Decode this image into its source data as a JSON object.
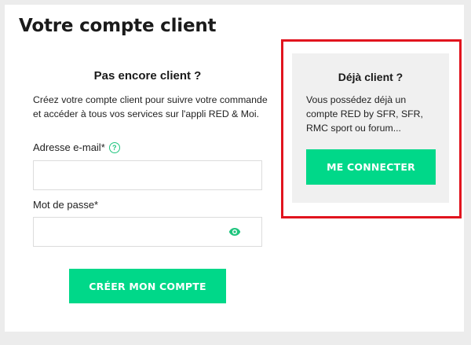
{
  "page": {
    "title": "Votre compte client"
  },
  "signup": {
    "title": "Pas encore client ?",
    "intro": "Créez votre compte client pour suivre votre commande et accéder à tous vos services sur l'appli RED & Moi.",
    "email_label": "Adresse e-mail*",
    "email_value": "",
    "password_label": "Mot de passe*",
    "password_value": "",
    "create_button": "CRÉER MON COMPTE"
  },
  "login": {
    "title": "Déjà client ?",
    "text": "Vous possédez déjà un compte RED by SFR, SFR, RMC sport ou forum...",
    "connect_button": "ME CONNECTER"
  },
  "colors": {
    "accent": "#00d889",
    "highlight": "#e1141e",
    "panel": "#f0f0f0"
  },
  "icons": {
    "help": "help-icon",
    "eye": "eye-icon"
  }
}
